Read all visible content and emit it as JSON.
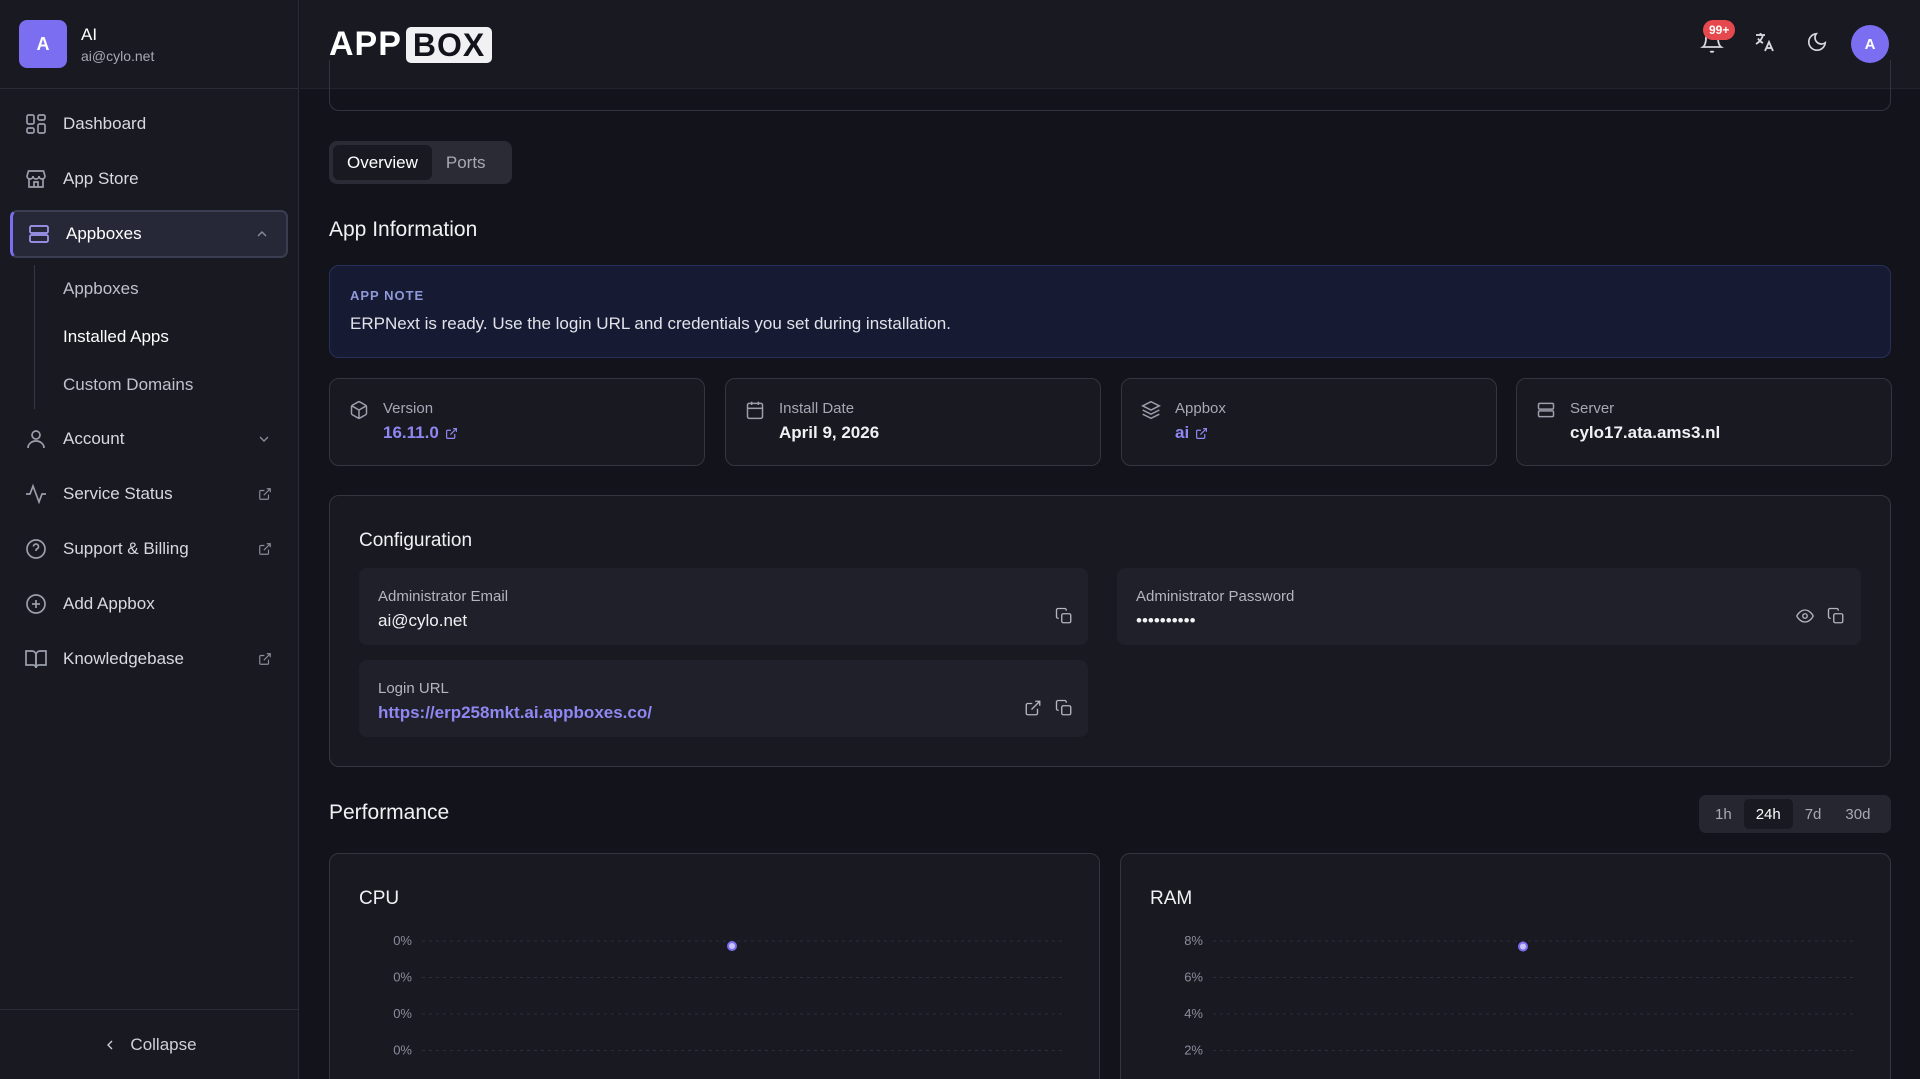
{
  "user": {
    "initial": "A",
    "name": "AI",
    "email": "ai@cylo.net"
  },
  "sidebar": {
    "items": [
      {
        "label": "Dashboard",
        "icon": "dashboard-icon"
      },
      {
        "label": "App Store",
        "icon": "store-icon"
      },
      {
        "label": "Appboxes",
        "icon": "server-icon",
        "expanded": true
      },
      {
        "label": "Account",
        "icon": "user-icon"
      },
      {
        "label": "Service Status",
        "icon": "activity-icon",
        "external": true
      },
      {
        "label": "Support & Billing",
        "icon": "help-circle-icon",
        "external": true
      },
      {
        "label": "Add Appbox",
        "icon": "plus-circle-icon"
      },
      {
        "label": "Knowledgebase",
        "icon": "book-icon",
        "external": true
      }
    ],
    "subitems": [
      "Appboxes",
      "Installed Apps",
      "Custom Domains"
    ],
    "current_subitem": "Installed Apps",
    "collapse_label": "Collapse"
  },
  "topbar": {
    "logo_app": "APP",
    "logo_box": "BOX",
    "notifications_count": "99+",
    "avatar_initial": "A"
  },
  "tabs": [
    {
      "label": "Overview",
      "active": true
    },
    {
      "label": "Ports",
      "active": false
    }
  ],
  "app_info": {
    "title": "App Information",
    "note_kicker": "APP NOTE",
    "note_text": "ERPNext is ready. Use the login URL and credentials you set during installation.",
    "cards": [
      {
        "label": "Version",
        "value": "16.11.0",
        "icon": "package-icon",
        "link": true
      },
      {
        "label": "Install Date",
        "value": "April 9, 2026",
        "icon": "calendar-icon",
        "link": false
      },
      {
        "label": "Appbox",
        "value": "ai",
        "icon": "layers-icon",
        "link": true
      },
      {
        "label": "Server",
        "value": "cylo17.ata.ams3.nl",
        "icon": "server-icon",
        "link": false
      }
    ]
  },
  "configuration": {
    "title": "Configuration",
    "admin_email_label": "Administrator Email",
    "admin_email": "ai@cylo.net",
    "admin_password_label": "Administrator Password",
    "admin_password_masked": "••••••••••",
    "login_url_label": "Login URL",
    "login_url": "https://erp258mkt.ai.appboxes.co/"
  },
  "performance": {
    "title": "Performance",
    "ranges": [
      "1h",
      "24h",
      "7d",
      "30d"
    ],
    "active_range": "24h"
  },
  "accent_color": "#7b6ef0",
  "chart_data": [
    {
      "type": "line",
      "title": "CPU",
      "y_tick_labels": [
        "0%",
        "0%",
        "0%",
        "0%"
      ],
      "series": [
        {
          "values": [
            0
          ]
        }
      ],
      "ylim": [
        0,
        0
      ],
      "grid": true
    },
    {
      "type": "line",
      "title": "RAM",
      "y_tick_labels": [
        "8%",
        "6%",
        "4%",
        "2%"
      ],
      "series": [
        {
          "values": [
            7.7
          ]
        }
      ],
      "ylim": [
        0,
        8
      ],
      "grid": true
    }
  ]
}
